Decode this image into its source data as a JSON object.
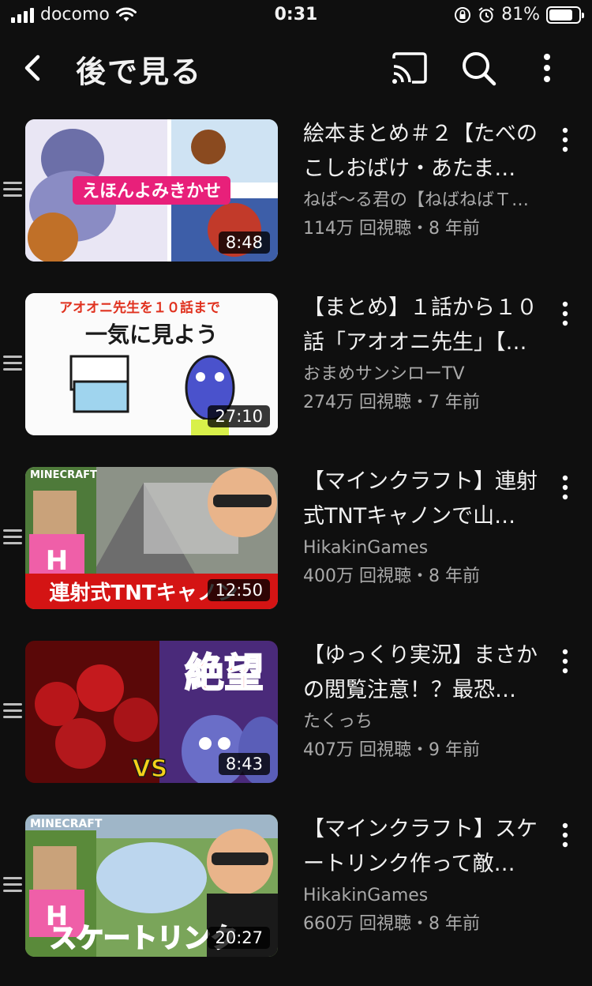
{
  "status": {
    "carrier": "docomo",
    "time": "0:31",
    "battery": "81%",
    "battery_level": 0.81
  },
  "header": {
    "title": "後で見る",
    "icons": [
      "back-chevron-icon",
      "cast-icon",
      "search-icon",
      "more-vert-icon"
    ]
  },
  "videos": [
    {
      "title": "絵本まとめ＃２【たべのこしおばけ・あたま…",
      "channel": "ねば〜る君の【ねばねばＴ…",
      "meta": "114万 回視聴・8 年前",
      "duration": "8:48",
      "thumb_text": "えほんよみきかせ"
    },
    {
      "title": "【まとめ】１話から１０話「アオオニ先生」【…",
      "channel": "おまめサンシローTV",
      "meta": "274万 回視聴・7 年前",
      "duration": "27:10",
      "thumb_text": "アオオニ先生を１０話まで",
      "thumb_text2": "一気に見よう"
    },
    {
      "title": "【マインクラフト】連射式TNTキャノンで山…",
      "channel": "HikakinGames",
      "meta": "400万 回視聴・8 年前",
      "duration": "12:50",
      "thumb_text": "連射式TNTキャノン",
      "thumb_logo": "MINECRAFT"
    },
    {
      "title": "【ゆっくり実況】まさかの閲覧注意！？最恐…",
      "channel": "たくっち",
      "meta": "407万 回視聴・9 年前",
      "duration": "8:43",
      "thumb_text": "絶望",
      "thumb_text2": "VS"
    },
    {
      "title": "【マインクラフト】スケートリンク作って敵…",
      "channel": "HikakinGames",
      "meta": "660万 回視聴・8 年前",
      "duration": "20:27",
      "thumb_text": "スケートリンク",
      "thumb_logo": "MINECRAFT"
    }
  ]
}
